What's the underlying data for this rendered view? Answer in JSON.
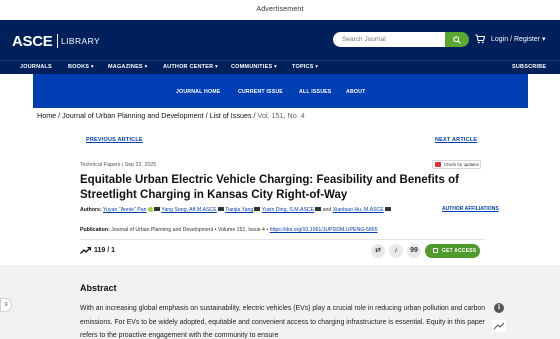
{
  "advertisement": "Advertisement",
  "header": {
    "logo": "ASCE",
    "logo_sub": "LIBRARY",
    "search_placeholder": "Search Journal",
    "login": "Login / Register ▾"
  },
  "primary_nav": {
    "items": [
      {
        "label": "JOURNALS"
      },
      {
        "label": "BOOKS ▾"
      },
      {
        "label": "MAGAZINES ▾"
      },
      {
        "label": "AUTHOR CENTER ▾"
      },
      {
        "label": "COMMUNITIES ▾"
      },
      {
        "label": "TOPICS ▾"
      }
    ],
    "subscribe": "SUBSCRIBE"
  },
  "journal_nav": {
    "items": [
      {
        "label": "JOURNAL HOME"
      },
      {
        "label": "CURRENT ISSUE"
      },
      {
        "label": "ALL ISSUES"
      },
      {
        "label": "ABOUT"
      }
    ]
  },
  "breadcrumb": {
    "path": "Home / Journal of Urban Planning and Development / List of Issues / ",
    "current": "Vol. 151, No. 4"
  },
  "article_nav": {
    "previous": "PREVIOUS ARTICLE",
    "next": "NEXT ARTICLE"
  },
  "article": {
    "meta": "Technical Papers  |  Sep 23, 2025",
    "check_updates": "Check for updates",
    "title": "Equitable Urban Electric Vehicle Charging: Feasibility and Benefits of Streetlight Charging in Kansas City Right-of-Way",
    "authors_label": "Authors:",
    "authors": [
      "Yuyan \"Annie\" Pan",
      "Yang Song, Aff.M.ASCE",
      "Tianjia Yang",
      "Yuxin Ding, S.M.ASCE",
      "Xianbiao Hu, M.ASCE"
    ],
    "authors_and": "and",
    "affiliations": "AUTHOR AFFILIATIONS",
    "publication_label": "Publication:",
    "publication": "Journal of Urban Planning and Development • Volume 151, Issue 4 •",
    "doi": "https://doi.org/10.1061/JUPDDM.UPENG-5865",
    "metrics": "119 / 1",
    "get_access": "GET ACCESS",
    "icons": {
      "cite": "99",
      "bell": "bell-icon",
      "share": "share-icon"
    }
  },
  "abstract": {
    "heading": "Abstract",
    "text": "With an increasing global emphasis on sustainability, electric vehicles (EVs) play a crucial role in reducing urban pollution and carbon emissions. For EVs to be widely adopted, equitable and convenient access to charging infrastructure is essential. Equity in this paper refers to the proactive engagement with the community to ensure"
  },
  "colors": {
    "header_bg": "#00205b",
    "journal_nav_bg": "#003eb3",
    "accent_green": "#4e9a2a",
    "link_blue": "#003eb3"
  }
}
